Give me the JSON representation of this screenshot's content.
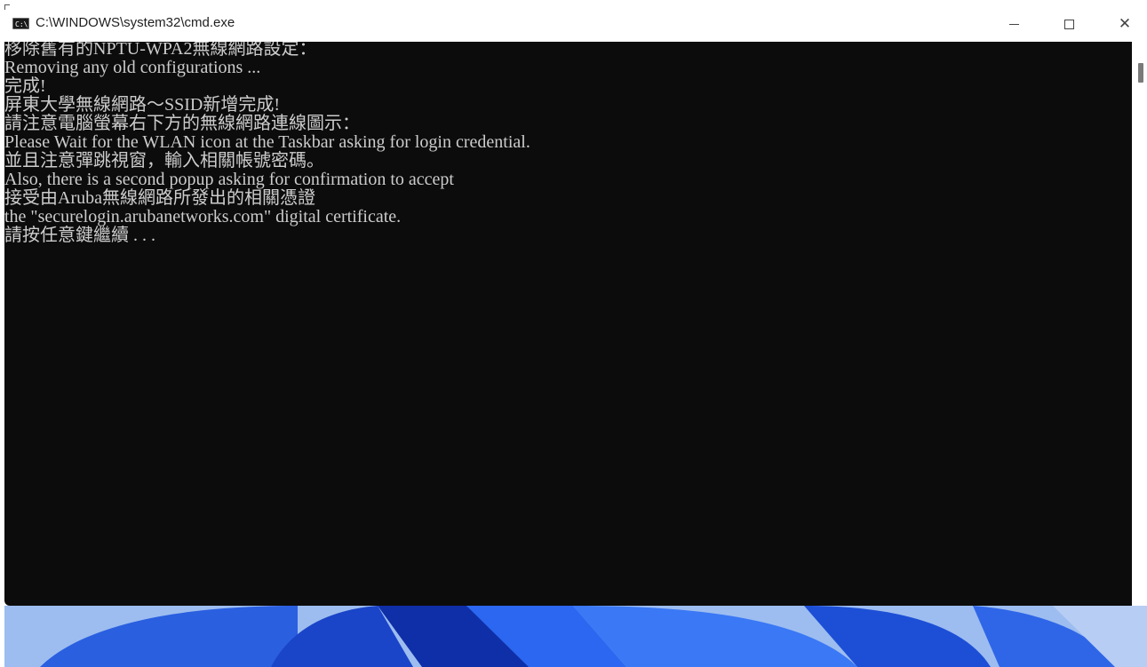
{
  "window": {
    "title": "C:\\WINDOWS\\system32\\cmd.exe",
    "icon": "cmd-icon",
    "icon_label": "C:\\"
  },
  "caption_buttons": {
    "minimize": "minimize-icon",
    "maximize": "maximize-icon",
    "close": "close-icon"
  },
  "console": {
    "background": "#0c0c0c",
    "foreground": "#cccccc",
    "lines": [
      "移除舊有的NPTU-WPA2無線網路設定：",
      "Removing any old configurations ...",
      "完成!",
      "屏東大學無線網路～SSID新增完成!",
      "請注意電腦螢幕右下方的無線網路連線圖示：",
      "Please Wait for the WLAN icon at the Taskbar asking for login credential.",
      "並且注意彈跳視窗，輸入相關帳號密碼。",
      "Also, there is a second popup asking for confirmation to accept",
      "接受由Aruba無線網路所發出的相關憑證",
      "the \"securelogin.arubanetworks.com\" digital certificate.",
      "請按任意鍵繼續 . . ."
    ]
  },
  "colors": {
    "wallpaper_base": "#7fa8e8",
    "wallpaper_blue": "#1f4fd8"
  }
}
